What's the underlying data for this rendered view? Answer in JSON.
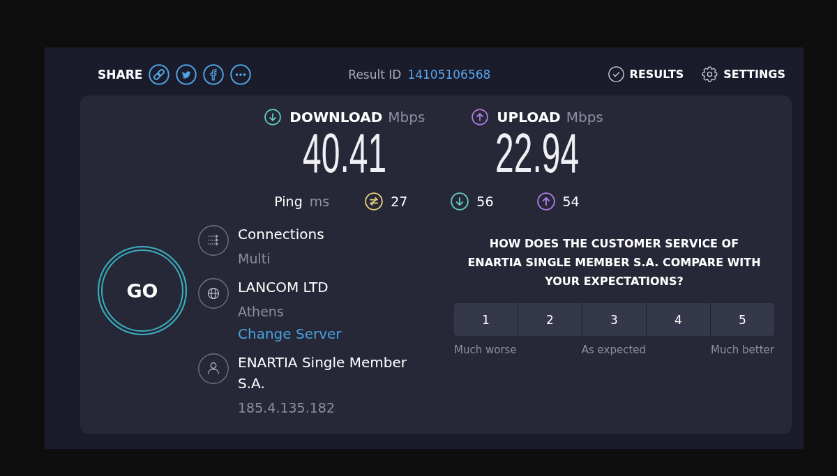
{
  "header": {
    "share_label": "SHARE",
    "result_id": {
      "label": "Result ID",
      "value": "14105106568"
    },
    "nav": [
      {
        "kind": "results",
        "label": "RESULTS"
      },
      {
        "kind": "settings",
        "label": "SETTINGS"
      }
    ]
  },
  "speeds": [
    {
      "kind": "download",
      "label": "DOWNLOAD",
      "unit": "Mbps",
      "value": "40.41",
      "color": "#62d2c4"
    },
    {
      "kind": "upload",
      "label": "UPLOAD",
      "unit": "Mbps",
      "value": "22.94",
      "color": "#b07ee8"
    }
  ],
  "ping": {
    "label": "Ping",
    "unit": "ms",
    "readings": [
      {
        "kind": "ping",
        "value": "27",
        "color": "#e8d27a"
      },
      {
        "kind": "download",
        "value": "56",
        "color": "#62d2c4"
      },
      {
        "kind": "upload",
        "value": "54",
        "color": "#b07ee8"
      }
    ]
  },
  "go_button": {
    "label": "GO"
  },
  "server_info": [
    {
      "kind": "connections",
      "title": "Connections",
      "detail": "Multi"
    },
    {
      "kind": "server",
      "title": "LANCOM LTD",
      "detail": "Athens",
      "link": "Change Server"
    },
    {
      "kind": "provider",
      "title": "ENARTIA Single Member S.A.",
      "detail": "185.4.135.182"
    }
  ],
  "survey": {
    "question": "HOW DOES THE CUSTOMER SERVICE OF ENARTIA SINGLE MEMBER S.A. COMPARE WITH YOUR EXPECTATIONS?",
    "options": [
      {
        "label": "1",
        "selected": false
      },
      {
        "label": "2",
        "selected": false
      },
      {
        "label": "3",
        "selected": false
      },
      {
        "label": "4",
        "selected": false
      },
      {
        "label": "5",
        "selected": false
      }
    ],
    "scale_labels": [
      "Much worse",
      "As expected",
      "Much better"
    ]
  }
}
